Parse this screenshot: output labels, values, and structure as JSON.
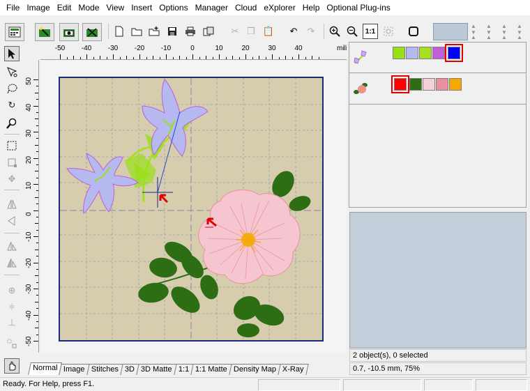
{
  "menu": [
    "File",
    "Image",
    "Edit",
    "Mode",
    "View",
    "Insert",
    "Options",
    "Manager",
    "Cloud",
    "eXplorer",
    "Help",
    "Optional Plug-ins"
  ],
  "ruler": {
    "h_labels": [
      "-50",
      "-40",
      "-30",
      "-20",
      "-10",
      "0",
      "10",
      "20",
      "30",
      "40"
    ],
    "h_unit": "milimeters",
    "v_labels": [
      "50",
      "40",
      "30",
      "20",
      "10",
      "0",
      "-10",
      "-20",
      "-30",
      "-40",
      "-50"
    ]
  },
  "tabs": [
    "Normal",
    "Image",
    "Stitches",
    "3D",
    "3D Matte",
    "1:1",
    "1:1 Matte",
    "Density Map",
    "X-Ray"
  ],
  "active_tab": "Normal",
  "objects": [
    {
      "name": "bellflower",
      "colors": [
        "#9adf1a",
        "#b6b8f0",
        "#a8e020",
        "#c25ed6",
        "#0000ff"
      ],
      "selected_color": 4
    },
    {
      "name": "wild-rose",
      "colors": [
        "#ff0000",
        "#2d6e14",
        "#f6d0d8",
        "#ea8ea0",
        "#f5a800"
      ],
      "selected_color": 0
    }
  ],
  "info": {
    "selection": "2 object(s), 0 selected",
    "coords": "0.7, -10.5 mm, 75%"
  },
  "status": {
    "text": "Ready. For Help, press F1."
  },
  "colors": {
    "hoop_fabric": "#d6cdae",
    "hoop_border": "#1c2a7a",
    "preview_bg": "#c2ced9",
    "grid_line": "#9a9aa8"
  }
}
